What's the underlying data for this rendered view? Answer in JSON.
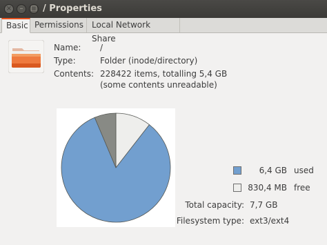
{
  "window": {
    "title": "/ Properties",
    "buttons": {
      "close": "×",
      "minimize": "–",
      "maximize": "□"
    }
  },
  "tabs": [
    {
      "label": "Basic",
      "active": true
    },
    {
      "label": "Permissions",
      "active": false
    },
    {
      "label": "Local Network Share",
      "active": false
    }
  ],
  "basic": {
    "icon": "folder-icon",
    "name_label": "Name:",
    "name_value": "/",
    "type_label": "Type:",
    "type_value": "Folder (inode/directory)",
    "contents_label": "Contents:",
    "contents_value": "228422 items, totalling 5,4 GB",
    "contents_note": "(some contents unreadable)"
  },
  "usage": {
    "used_value": "6,4 GB",
    "used_label": "used",
    "free_value": "830,4 MB",
    "free_label": "free",
    "capacity_label": "Total capacity:",
    "capacity_value": "7,7 GB",
    "fstype_label": "Filesystem type:",
    "fstype_value": "ext3/ext4",
    "colors": {
      "used": "#729fcf",
      "free": "#eeeeec",
      "unknown": "#888a85"
    }
  },
  "chart_data": {
    "type": "pie",
    "slices": [
      {
        "name": "used",
        "value": 6.4,
        "color": "#729fcf"
      },
      {
        "name": "free",
        "value": 0.81,
        "color": "#eeeeec"
      },
      {
        "name": "unknown",
        "value": 0.49,
        "color": "#888a85"
      }
    ]
  }
}
